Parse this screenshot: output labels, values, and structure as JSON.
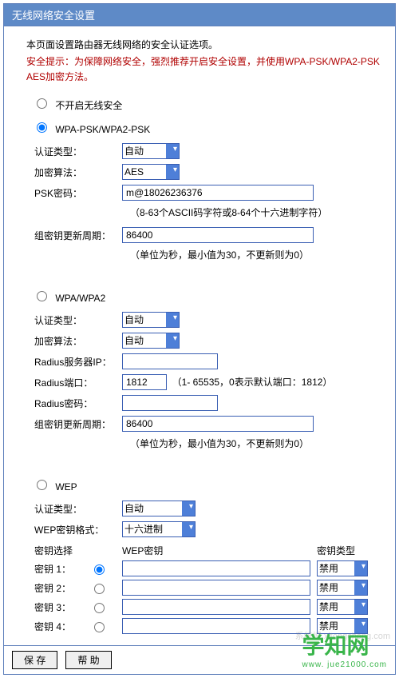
{
  "title": "无线网络安全设置",
  "intro": "本页面设置路由器无线网络的安全认证选项。",
  "warning": "安全提示：为保障网络安全，强烈推荐开启安全设置，并使用WPA-PSK/WPA2-PSK AES加密方法。",
  "radios": {
    "disable": "不开启无线安全",
    "wpapsk": "WPA-PSK/WPA2-PSK",
    "wpa": "WPA/WPA2",
    "wep": "WEP"
  },
  "labels": {
    "auth": "认证类型：",
    "encrypt": "加密算法：",
    "psk": "PSK密码：",
    "rekey": "组密钥更新周期：",
    "radius_ip": "Radius服务器IP：",
    "radius_port": "Radius端口：",
    "radius_pwd": "Radius密码：",
    "wep_format": "WEP密钥格式：",
    "wep_select": "密钥选择",
    "wep_key": "WEP密钥",
    "wep_type": "密钥类型",
    "key1": "密钥 1：",
    "key2": "密钥 2：",
    "key3": "密钥 3：",
    "key4": "密钥 4："
  },
  "values": {
    "wpapsk_auth": "自动",
    "wpapsk_encrypt": "AES",
    "psk_value": "m@18026236376",
    "psk_hint": "（8-63个ASCII码字符或8-64个十六进制字符）",
    "rekey_value": "86400",
    "rekey_hint": "（单位为秒，最小值为30，不更新则为0）",
    "wpa_auth": "自动",
    "wpa_encrypt": "自动",
    "radius_ip": "",
    "radius_port": "1812",
    "radius_port_hint": "（1- 65535，0表示默认端口：1812）",
    "radius_pwd": "",
    "wpa_rekey": "86400",
    "wep_auth": "自动",
    "wep_format": "十六进制",
    "wep_disable": "禁用"
  },
  "buttons": {
    "save": "保 存",
    "help": "帮 助"
  },
  "watermark": "系统城\nxitongcheng.com",
  "logo": "学知网",
  "logo_sub": "www. jue21000.com"
}
